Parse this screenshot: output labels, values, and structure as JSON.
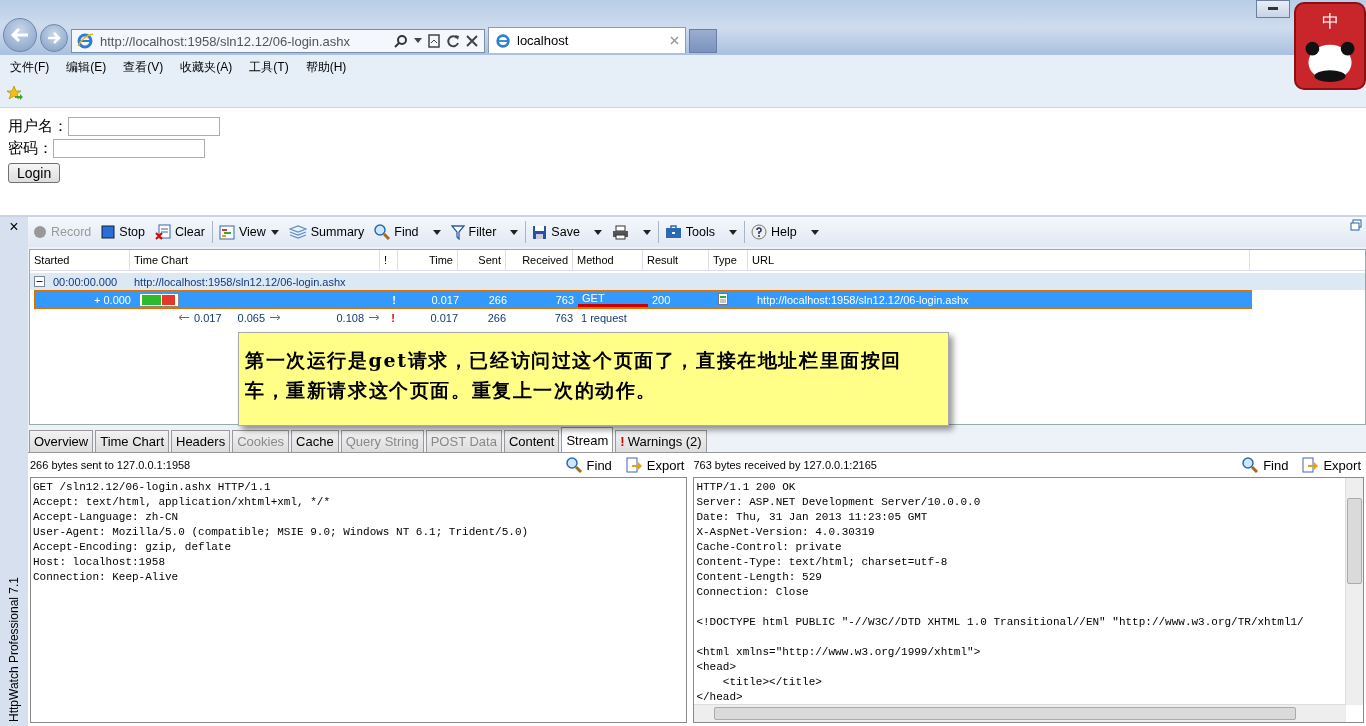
{
  "browser": {
    "address": "http://localhost:1958/sln12.12/06-login.ashx",
    "tabs": [
      {
        "label": "localhost",
        "selected": true
      }
    ],
    "ime": "中"
  },
  "menu": [
    "文件(F)",
    "编辑(E)",
    "查看(V)",
    "收藏夹(A)",
    "工具(T)",
    "帮助(H)"
  ],
  "page": {
    "fields": [
      {
        "label": "用户名："
      },
      {
        "label": "密码："
      }
    ],
    "button": "Login"
  },
  "httpwatch": {
    "title": "HttpWatch Professional 7.1",
    "close": "×",
    "toolbar": [
      {
        "kind": "record",
        "label": "Record",
        "disabled": true,
        "dropdown": false,
        "separator_before": false
      },
      {
        "kind": "stop",
        "label": "Stop",
        "disabled": false,
        "dropdown": false,
        "separator_before": false
      },
      {
        "kind": "clear",
        "label": "Clear",
        "disabled": false,
        "dropdown": false,
        "separator_before": false
      },
      {
        "kind": "view",
        "label": "View",
        "disabled": false,
        "dropdown": true,
        "separator_before": true
      },
      {
        "kind": "summary",
        "label": "Summary",
        "disabled": false,
        "dropdown": false,
        "separator_before": false
      },
      {
        "kind": "find",
        "label": "Find",
        "disabled": false,
        "dropdown": true,
        "separator_before": false
      },
      {
        "kind": "filter",
        "label": "Filter",
        "disabled": false,
        "dropdown": true,
        "separator_before": false
      },
      {
        "kind": "save",
        "label": "Save",
        "disabled": false,
        "dropdown": true,
        "separator_before": true
      },
      {
        "kind": "print",
        "disabled": false,
        "dropdown": true,
        "separator_before": false
      },
      {
        "kind": "tools",
        "label": "Tools",
        "disabled": false,
        "dropdown": true,
        "separator_before": true
      },
      {
        "kind": "help",
        "label": "Help",
        "disabled": false,
        "dropdown": true,
        "separator_before": true
      }
    ],
    "columns": [
      "Started",
      "Time Chart",
      "!",
      "Time",
      "Sent",
      "Received",
      "Method",
      "Result",
      "Type",
      "URL"
    ],
    "group": {
      "expanded": true,
      "started": "00:00:00.000",
      "url": "http://localhost:1958/sln12.12/06-login.ashx"
    },
    "rows": [
      {
        "selected": true,
        "started": "+ 0.000",
        "warning": "!",
        "time": "0.017",
        "sent": "266",
        "received": "763",
        "method": "GET",
        "result": "200",
        "url": "http://localhost:1958/sln12.12/06-login.ashx"
      }
    ],
    "summary": {
      "timings": [
        "0.017",
        "0.065",
        "0.108"
      ],
      "warning": "!",
      "time": "0.017",
      "sent": "266",
      "received": "763",
      "requests": "1 request"
    },
    "note": "第一次运行是get请求，已经访问过这个页面了，直接在地址栏里面按回车，重新请求这个页面。重复上一次的动作。",
    "tabs": [
      {
        "label": "Overview",
        "selected": false,
        "disabled": false
      },
      {
        "label": "Time Chart",
        "selected": false,
        "disabled": false
      },
      {
        "label": "Headers",
        "selected": false,
        "disabled": false
      },
      {
        "label": "Cookies",
        "selected": false,
        "disabled": true
      },
      {
        "label": "Cache",
        "selected": false,
        "disabled": false
      },
      {
        "label": "Query String",
        "selected": false,
        "disabled": true
      },
      {
        "label": "POST Data",
        "selected": false,
        "disabled": true
      },
      {
        "label": "Content",
        "selected": false,
        "disabled": false
      },
      {
        "label": "Stream",
        "selected": true,
        "disabled": false
      },
      {
        "label": "Warnings (2)",
        "selected": false,
        "disabled": false,
        "mark": "!"
      }
    ],
    "panes": [
      {
        "caption": "266 bytes sent to 127.0.0.1:1958",
        "find": "Find",
        "export": "Export",
        "scrollbars": false,
        "blocks": [
          [
            "GET /sln12.12/06-login.ashx HTTP/1.1",
            "Accept: text/html, application/xhtml+xml, */*",
            "Accept-Language: zh-CN",
            "User-Agent: Mozilla/5.0 (compatible; MSIE 9.0; Windows NT 6.1; Trident/5.0)",
            "Accept-Encoding: gzip, deflate",
            "Host: localhost:1958",
            "Connection: Keep-Alive"
          ]
        ]
      },
      {
        "caption": "763 bytes received by 127.0.0.1:2165",
        "find": "Find",
        "export": "Export",
        "scrollbars": true,
        "blocks": [
          [
            "HTTP/1.1 200 OK",
            "Server: ASP.NET Development Server/10.0.0.0",
            "Date: Thu, 31 Jan 2013 11:23:05 GMT",
            "X-AspNet-Version: 4.0.30319",
            "Cache-Control: private",
            "Content-Type: text/html; charset=utf-8",
            "Content-Length: 529",
            "Connection: Close"
          ],
          [
            "<!DOCTYPE html PUBLIC \"-//W3C//DTD XHTML 1.0 Transitional//EN\" \"http://www.w3.org/TR/xhtml1/"
          ],
          [
            "<html xmlns=\"http://www.w3.org/1999/xhtml\">",
            "<head>",
            "    <title></title>",
            "</head>"
          ]
        ]
      }
    ]
  }
}
